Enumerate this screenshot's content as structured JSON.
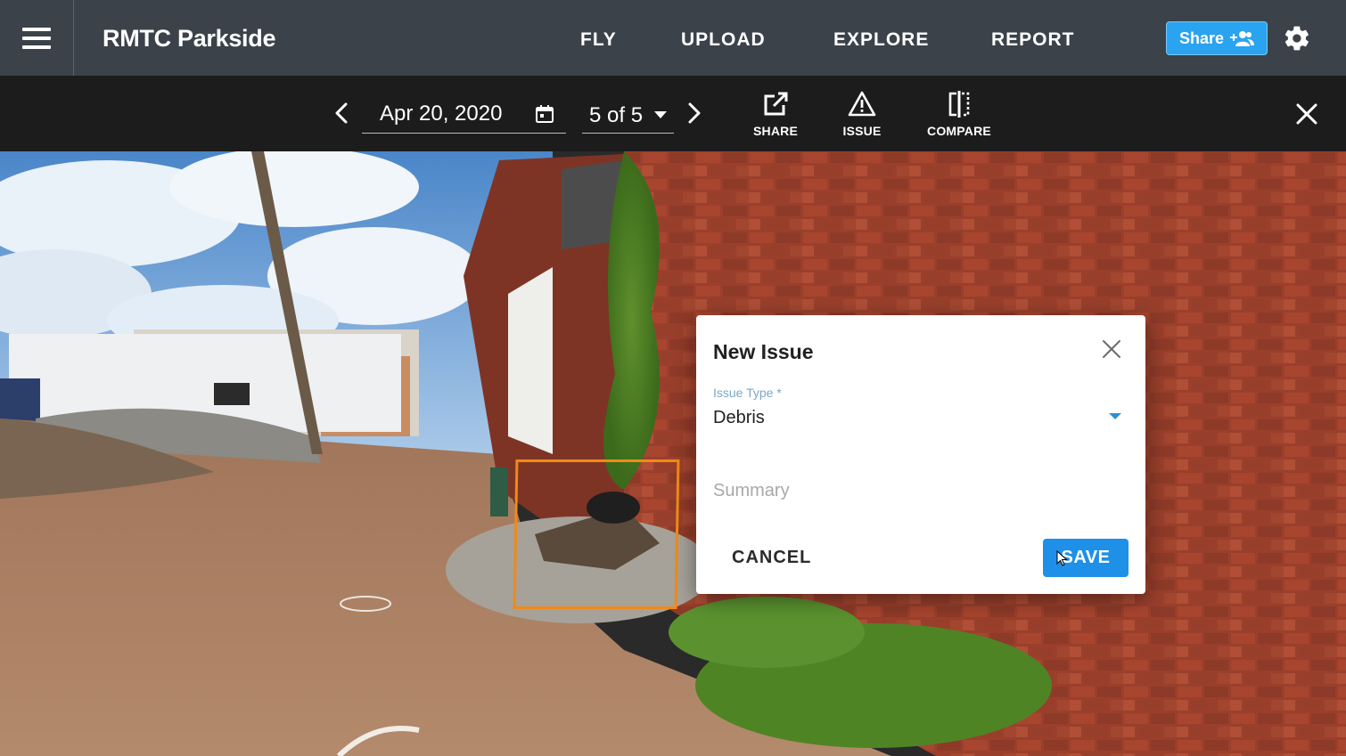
{
  "header": {
    "project_title": "RMTC Parkside",
    "nav": [
      "FLY",
      "UPLOAD",
      "EXPLORE",
      "REPORT"
    ],
    "share_label": "Share"
  },
  "toolbar": {
    "date": "Apr 20, 2020",
    "capture_index": "5 of 5",
    "share_label": "SHARE",
    "issue_label": "ISSUE",
    "compare_label": "COMPARE"
  },
  "dialog": {
    "title": "New Issue",
    "issue_type_label": "Issue Type",
    "required_mark": "*",
    "issue_type_value": "Debris",
    "summary_placeholder": "Summary",
    "cancel_label": "CANCEL",
    "save_label": "SAVE"
  },
  "colors": {
    "topbar": "#3b4249",
    "toolbar": "#1c1c1c",
    "accent": "#1e90e8",
    "highlight": "#f08a17"
  },
  "icons": [
    "menu-icon",
    "share-people-icon",
    "gear-icon",
    "chevron-left-icon",
    "calendar-icon",
    "caret-down-icon",
    "chevron-right-icon",
    "share-external-icon",
    "warning-icon",
    "compare-icon",
    "close-icon"
  ]
}
